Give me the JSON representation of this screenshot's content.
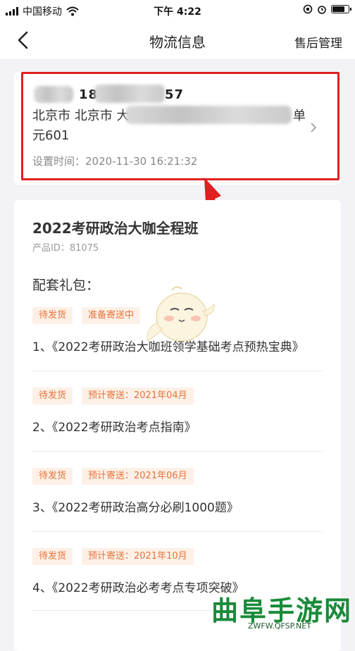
{
  "status_bar": {
    "carrier": "中国移动",
    "time": "下午 4:22"
  },
  "nav": {
    "title": "物流信息",
    "right_action": "售后管理"
  },
  "address": {
    "name_visible": "18",
    "phone_tail": "57",
    "line1": "北京市 北京市 大",
    "line1_tail": "单",
    "line2": "元601",
    "set_time": "设置时间：2020-11-30 16:21:32"
  },
  "product": {
    "title": "2022考研政治大咖全程班",
    "product_id": "产品ID：81075",
    "gift_heading": "配套礼包："
  },
  "gifts": [
    {
      "status": "待发货",
      "shipping": "准备寄送中",
      "name": "1、《2022考研政治大咖班领学基础考点预热宝典》"
    },
    {
      "status": "待发货",
      "shipping": "预计寄送：2021年04月",
      "name": "2、《2022考研政治考点指南》"
    },
    {
      "status": "待发货",
      "shipping": "预计寄送：2021年06月",
      "name": "3、《2022考研政治高分必刷1000题》"
    },
    {
      "status": "待发货",
      "shipping": "预计寄送：2021年10月",
      "name": "4、《2022考研政治必考考点专项突破》"
    }
  ],
  "watermark": {
    "text": "曲阜手游网",
    "url": "ZWFW.QFSP.NET"
  },
  "colors": {
    "highlight": "#e02020",
    "tag_bg": "#fdf0e6",
    "tag_text": "#e8733a",
    "watermark": "#1a8a3a"
  },
  "icons": [
    "signal-icon",
    "wifi-icon",
    "battery-icon",
    "back-icon",
    "chevron-right-icon",
    "arrow-annotation",
    "mascot-icon"
  ]
}
